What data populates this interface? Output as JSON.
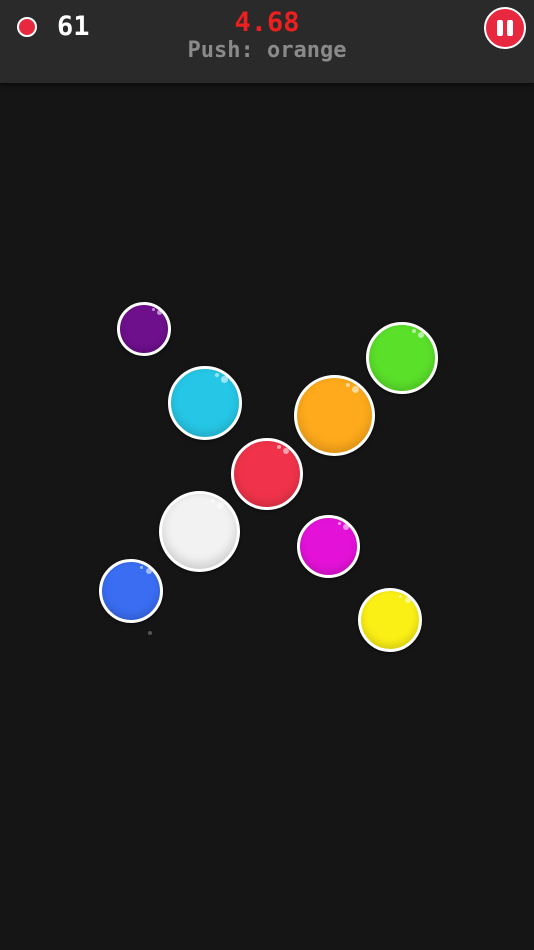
{
  "header": {
    "score_icon": "red-circle-icon",
    "score": "61",
    "timer": "4.68",
    "instruction": "Push: orange",
    "pause_icon": "pause-icon"
  },
  "colors": {
    "background": "#151515",
    "topbar": "#2a2a2a",
    "accent_red": "#e8283f",
    "timer": "#ee1f1f",
    "instruction": "#8a8a8a"
  },
  "bubbles": [
    {
      "color": "purple",
      "hex": "#6e0f8c"
    },
    {
      "color": "cyan",
      "hex": "#26c7e6"
    },
    {
      "color": "green",
      "hex": "#5be02a"
    },
    {
      "color": "orange",
      "hex": "#ffaa1c"
    },
    {
      "color": "red",
      "hex": "#f0334a"
    },
    {
      "color": "white",
      "hex": "#f2f2f2"
    },
    {
      "color": "magenta",
      "hex": "#e412d8"
    },
    {
      "color": "blue",
      "hex": "#3a6df2"
    },
    {
      "color": "yellow",
      "hex": "#fbf016"
    }
  ]
}
